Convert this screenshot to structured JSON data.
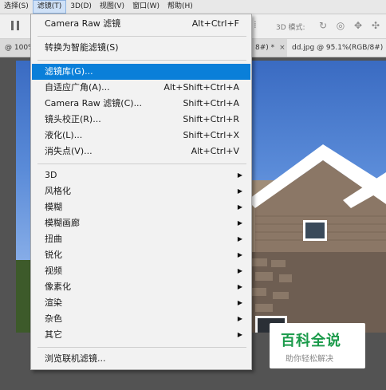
{
  "menubar": {
    "items": [
      "选择(S)",
      "滤镜(T)",
      "3D(D)",
      "视图(V)",
      "窗口(W)",
      "帮助(H)"
    ]
  },
  "optbar": {
    "mode_label": "3D 模式:",
    "icons": [
      "rotate-3d-icon",
      "roll-3d-icon",
      "pan-3d-icon",
      "slide-3d-icon"
    ]
  },
  "tabs": [
    {
      "label": "@ 100%",
      "close": ""
    },
    {
      "label": "8#) *",
      "close": "×"
    },
    {
      "label": "dd.jpg @ 95.1%(RGB/8#)",
      "close": ""
    }
  ],
  "dropdown": {
    "top": [
      {
        "label": "Camera Raw 滤镜",
        "shortcut": "Alt+Ctrl+F"
      },
      {
        "label": "转换为智能滤镜(S)",
        "shortcut": ""
      }
    ],
    "middle": [
      {
        "label": "滤镜库(G)...",
        "shortcut": "",
        "highlighted": true
      },
      {
        "label": "自适应广角(A)...",
        "shortcut": "Alt+Shift+Ctrl+A"
      },
      {
        "label": "Camera Raw 滤镜(C)...",
        "shortcut": "Shift+Ctrl+A"
      },
      {
        "label": "镜头校正(R)...",
        "shortcut": "Shift+Ctrl+R"
      },
      {
        "label": "液化(L)...",
        "shortcut": "Shift+Ctrl+X"
      },
      {
        "label": "消失点(V)...",
        "shortcut": "Alt+Ctrl+V"
      }
    ],
    "submenus": [
      "3D",
      "风格化",
      "模糊",
      "模糊画廊",
      "扭曲",
      "锐化",
      "视频",
      "像素化",
      "渲染",
      "杂色",
      "其它"
    ],
    "bottom": [
      {
        "label": "浏览联机滤镜...",
        "shortcut": ""
      }
    ]
  },
  "watermark": {
    "title": "百科全说",
    "subtitle": "助你轻松解决"
  },
  "photo": {
    "house_number": "1316"
  },
  "colors": {
    "highlight": "#0a7fd9",
    "watermark_green": "#1a9a4a"
  }
}
